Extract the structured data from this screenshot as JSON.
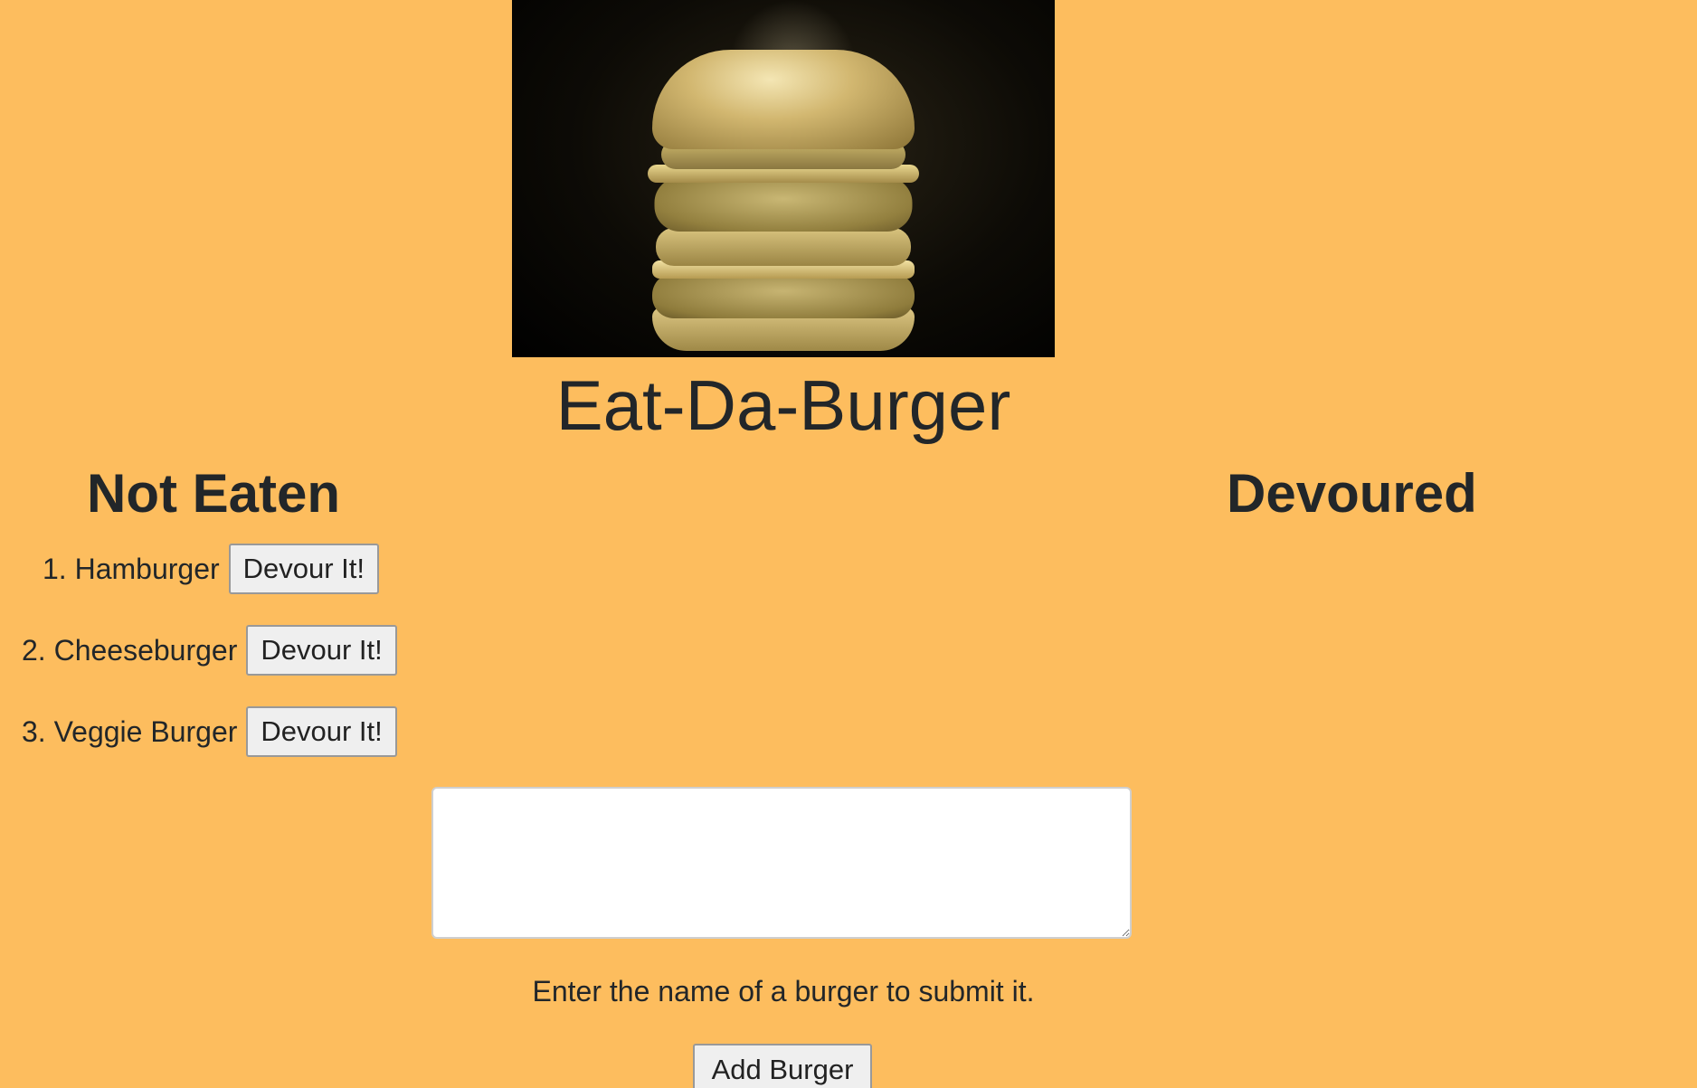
{
  "app": {
    "title": "Eat-Da-Burger",
    "background_color": "#FDBD5E",
    "hero_image": "golden-burger-image"
  },
  "columns": {
    "not_eaten_heading": "Not Eaten",
    "devoured_heading": "Devoured"
  },
  "burgers": [
    {
      "number": "1.",
      "name": "Hamburger",
      "button_label": "Devour It!"
    },
    {
      "number": "2.",
      "name": "Cheeseburger",
      "button_label": "Devour It!"
    },
    {
      "number": "3.",
      "name": "Veggie Burger",
      "button_label": "Devour It!"
    }
  ],
  "form": {
    "input_value": "",
    "help_text": "Enter the name of a burger to submit it.",
    "submit_label": "Add Burger"
  }
}
